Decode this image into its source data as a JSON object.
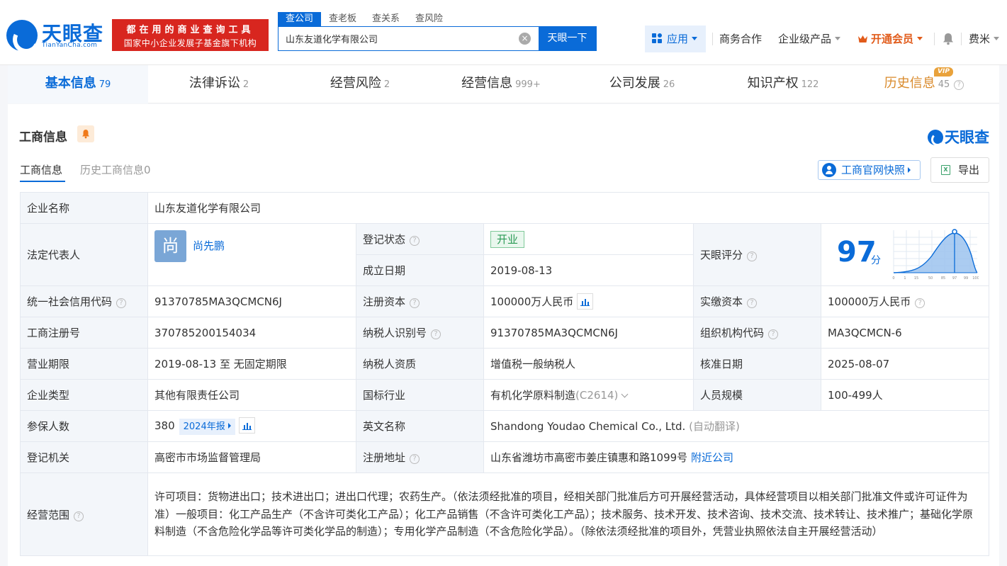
{
  "header": {
    "logo_cn": "天眼查",
    "logo_en": "TianYanCha.com",
    "banner_line1": "都在用的商业查询工具",
    "banner_line2": "国家中小企业发展子基金旗下机构",
    "search_tabs": [
      "查公司",
      "查老板",
      "查关系",
      "查风险"
    ],
    "search_value": "山东友道化学有限公司",
    "search_button": "天眼一下",
    "nav_app": "应用",
    "nav_business": "商务合作",
    "nav_enterprise": "企业级产品",
    "nav_vip": "开通会员",
    "nav_user": "费米"
  },
  "tabs": [
    {
      "label": "基本信息",
      "count": "79"
    },
    {
      "label": "法律诉讼",
      "count": "2"
    },
    {
      "label": "经营风险",
      "count": "2"
    },
    {
      "label": "经营信息",
      "count": "999+"
    },
    {
      "label": "公司发展",
      "count": "26"
    },
    {
      "label": "知识产权",
      "count": "122"
    },
    {
      "label": "历史信息",
      "count": "45"
    }
  ],
  "vip_badge": "VIP",
  "section": {
    "title": "工商信息",
    "watermark": "天眼查",
    "subtab_active": "工商信息",
    "subtab_history": "历史工商信息0",
    "snapshot_button": "工商官网快照",
    "export_button": "导出",
    "xls_glyph": "X"
  },
  "info": {
    "company_label": "企业名称",
    "company_value": "山东友道化学有限公司",
    "legal_label": "法定代表人",
    "legal_avatar": "尚",
    "legal_name": "尚先鹏",
    "status_label": "登记状态",
    "status_value": "开业",
    "found_label": "成立日期",
    "found_value": "2019-08-13",
    "score_label": "天眼评分",
    "score_value": "97",
    "score_unit": "分",
    "credit_label": "统一社会信用代码",
    "credit_value": "91370785MA3QCMCN6J",
    "capital_label": "注册资本",
    "capital_value": "100000万人民币",
    "paid_label": "实缴资本",
    "paid_value": "100000万人民币",
    "regno_label": "工商注册号",
    "regno_value": "370785200154034",
    "taxid_label": "纳税人识别号",
    "taxid_value": "91370785MA3QCMCN6J",
    "org_label": "组织机构代码",
    "org_value": "MA3QCMCN-6",
    "term_label": "营业期限",
    "term_value": "2019-08-13 至 无固定期限",
    "taxq_label": "纳税人资质",
    "taxq_value": "增值税一般纳税人",
    "approve_label": "核准日期",
    "approve_value": "2025-08-07",
    "type_label": "企业类型",
    "type_value": "其他有限责任公司",
    "industry_label": "国标行业",
    "industry_value": "有机化学原料制造",
    "industry_code": "(C2614)",
    "staff_label": "人员规模",
    "staff_value": "100-499人",
    "insured_label": "参保人数",
    "insured_value": "380",
    "insured_year": "2024年报",
    "english_label": "英文名称",
    "english_value": "Shandong Youdao Chemical Co., Ltd.",
    "english_note": "(自动翻译)",
    "authority_label": "登记机关",
    "authority_value": "高密市市场监督管理局",
    "address_label": "注册地址",
    "address_value": "山东省潍坊市高密市姜庄镇惠和路1099号",
    "address_link": "附近公司",
    "scope_label": "经营范围",
    "scope_value": "许可项目：货物进出口；技术进出口；进出口代理；农药生产。（依法须经批准的项目，经相关部门批准后方可开展经营活动，具体经营项目以相关部门批准文件或许可证件为准）一般项目：化工产品生产（不含许可类化工产品）；化工产品销售（不含许可类化工产品）；技术服务、技术开发、技术咨询、技术交流、技术转让、技术推广；基础化学原料制造（不含危险化学品等许可类化学品的制造）；专用化学产品制造（不含危险化学品）。（除依法须经批准的项目外，凭营业执照依法自主开展经营活动）"
  },
  "score_chart": {
    "ticks": [
      "0",
      "1",
      "15",
      "50",
      "85",
      "97",
      "99",
      "100"
    ],
    "marker": "97"
  },
  "colors": {
    "brand": "#0a6bd8",
    "banner": "#d8261f",
    "vip": "#e15b1a",
    "status_green": "#2a9a55"
  }
}
